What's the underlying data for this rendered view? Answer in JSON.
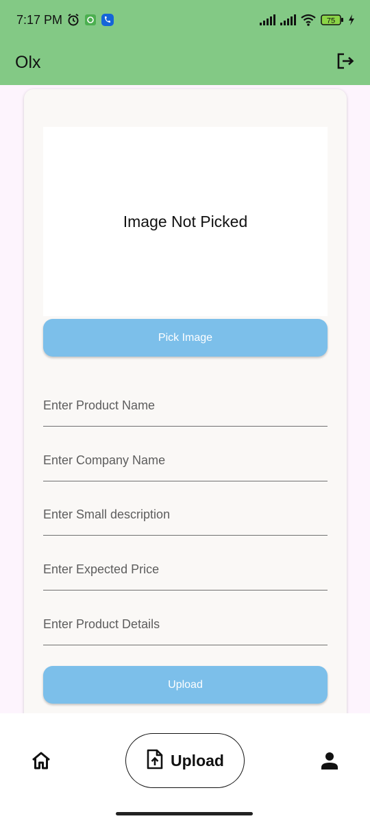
{
  "status_bar": {
    "time": "7:17 PM",
    "battery_level": "75",
    "icons": [
      "alarm-icon",
      "android-app-icon",
      "phone-app-icon",
      "signal-icon",
      "signal-icon",
      "wifi-icon",
      "battery-icon",
      "charging-icon"
    ]
  },
  "app_bar": {
    "title": "Olx",
    "action_icon": "logout-icon"
  },
  "colors": {
    "app_bar": "#83c985",
    "button": "#7cbfea",
    "card": "#faf8f6",
    "page_background": "#fdf4fd"
  },
  "image_picker": {
    "message": "Image Not Picked",
    "button_label": "Pick Image"
  },
  "form": {
    "fields": [
      {
        "placeholder": "Enter Product Name",
        "value": ""
      },
      {
        "placeholder": "Enter Company Name",
        "value": ""
      },
      {
        "placeholder": "Enter Small description",
        "value": ""
      },
      {
        "placeholder": "Enter Expected Price",
        "value": ""
      },
      {
        "placeholder": "Enter Product Details",
        "value": ""
      }
    ],
    "submit_label": "Upload"
  },
  "bottom_nav": {
    "items": [
      {
        "icon": "home-icon",
        "label": ""
      },
      {
        "icon": "upload-file-icon",
        "label": "Upload",
        "selected": true
      },
      {
        "icon": "person-icon",
        "label": ""
      }
    ]
  }
}
